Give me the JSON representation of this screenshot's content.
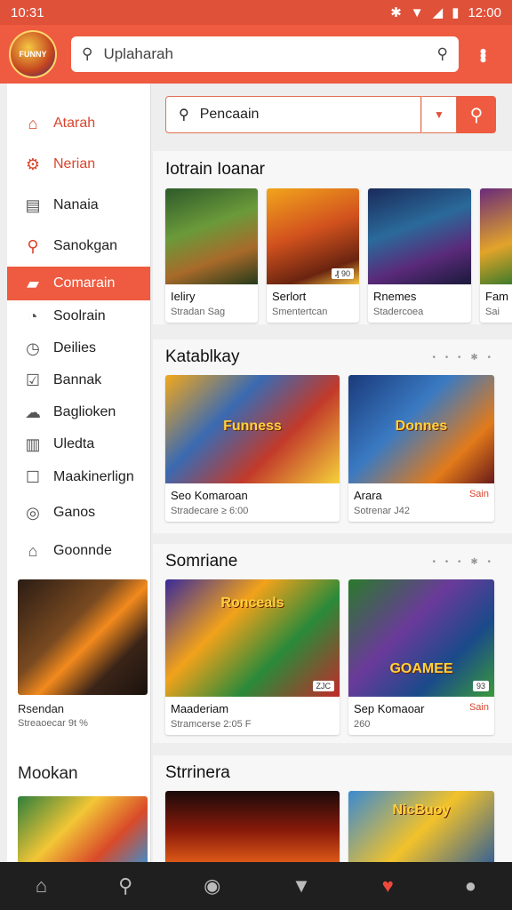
{
  "status": {
    "time": "10:31",
    "right_time": "12:00",
    "icons": [
      "bluetooth-icon",
      "wifi-icon",
      "signal-icon",
      "battery-icon"
    ]
  },
  "header": {
    "logo_text": "FUNNY",
    "search_value": "Uplaharah",
    "accent": "#ee5b40"
  },
  "sidebar": {
    "items": [
      {
        "label": "Atarah",
        "icon": "home-icon"
      },
      {
        "label": "Nerian",
        "icon": "gear-icon"
      },
      {
        "label": "Nanaia",
        "icon": "calendar-icon"
      },
      {
        "label": "Sanokgan",
        "icon": "search-icon"
      },
      {
        "label": "Comarain",
        "icon": "folder-icon"
      },
      {
        "label": "Soolrain",
        "icon": "check-circle-icon"
      },
      {
        "label": "Deilies",
        "icon": "clock-icon"
      },
      {
        "label": "Bannak",
        "icon": "checkbox-icon"
      },
      {
        "label": "Baglioken",
        "icon": "cloud-icon"
      },
      {
        "label": "Uledta",
        "icon": "chart-icon"
      },
      {
        "label": "Maakinerlign",
        "icon": "list-icon"
      },
      {
        "label": "Ganos",
        "icon": "target-icon"
      },
      {
        "label": "Goonnde",
        "icon": "tag-icon"
      }
    ],
    "card": {
      "title": "Rsendan",
      "sub": "Streaoecar 9t %"
    },
    "heading": "Mookan"
  },
  "main": {
    "search": {
      "value": "Pencaain"
    },
    "sections": [
      {
        "title": "Iotrain Ioanar",
        "cards": [
          {
            "title": "Ieliry",
            "sub": "Stradan Sag"
          },
          {
            "title": "Serlort",
            "sub": "Smentertcan",
            "badge": "₰ 90"
          },
          {
            "title": "Rnemes",
            "sub": "Stadercoea"
          },
          {
            "title": "Fam",
            "sub": "Sai"
          }
        ]
      },
      {
        "title": "Katablkay",
        "cards": [
          {
            "title": "Seo Komaroan",
            "sub": "Stradecare ≥ 6:00",
            "thumb_text": "Funness"
          },
          {
            "title": "Arara",
            "sub": "Sotrenar J42",
            "sale": "Sain",
            "thumb_text": "Donnes"
          }
        ]
      },
      {
        "title": "Somriane",
        "cards": [
          {
            "title": "Maaderiam",
            "sub": "Stramcerse 2:05 F",
            "badge": "ZJC",
            "thumb_text": "Ronceals"
          },
          {
            "title": "Sep Komaoar",
            "sub": "260",
            "sale": "Sain",
            "badge": "93",
            "thumb_text": "GOAMEE"
          }
        ]
      },
      {
        "title": "Strrinera",
        "cards": [
          {
            "title": "",
            "sub": ""
          },
          {
            "title": "",
            "sub": "",
            "thumb_text": "NicBuoy"
          }
        ]
      }
    ]
  },
  "bottom_nav": [
    "home-icon",
    "search-icon",
    "games-icon",
    "bookmark-icon",
    "heart-icon",
    "profile-icon"
  ]
}
